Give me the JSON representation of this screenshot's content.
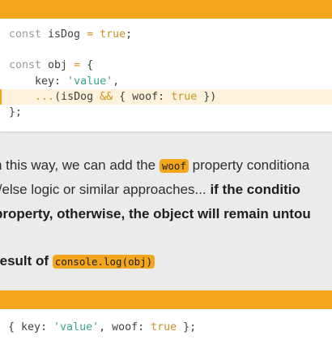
{
  "code_block_1": {
    "lines": [
      {
        "t": "const isDog = true;"
      },
      {
        "t": ""
      },
      {
        "t": "const obj = {"
      },
      {
        "t": "    key: 'value',"
      },
      {
        "t": "    ...(isDog && { woof: true })"
      },
      {
        "t": "};"
      }
    ]
  },
  "paragraph": {
    "line1_pre": "n this way, we can add the ",
    "line1_code": "woof",
    "line1_post": " property conditiona",
    "line2_pre": "f/else logic or similar approaches... ",
    "line2_bold": "if the conditio",
    "line3_bold": "property, otherwise, the object will remain untou"
  },
  "result_heading": {
    "text": "result of ",
    "code": "console.log(obj)"
  },
  "code_block_2": {
    "line": "{ key: 'value', woof: true };"
  }
}
